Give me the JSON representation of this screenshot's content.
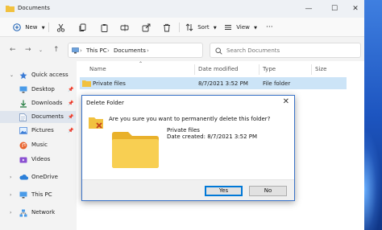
{
  "window": {
    "title": "Documents",
    "controls": [
      "—",
      "☐",
      "✕"
    ]
  },
  "toolbar": {
    "new_label": "New",
    "sort_label": "Sort",
    "view_label": "View",
    "more_label": "···"
  },
  "address": {
    "path": [
      "This PC",
      "Documents"
    ],
    "search_placeholder": "Search Documents"
  },
  "sidebar": {
    "items": [
      {
        "label": "Quick access",
        "icon": "star-icon"
      },
      {
        "label": "Desktop",
        "icon": "desktop-icon"
      },
      {
        "label": "Downloads",
        "icon": "download-icon"
      },
      {
        "label": "Documents",
        "icon": "documents-icon"
      },
      {
        "label": "Pictures",
        "icon": "pictures-icon"
      },
      {
        "label": "Music",
        "icon": "music-icon"
      },
      {
        "label": "Videos",
        "icon": "videos-icon"
      },
      {
        "label": "OneDrive",
        "icon": "cloud-icon"
      },
      {
        "label": "This PC",
        "icon": "pc-icon"
      },
      {
        "label": "Network",
        "icon": "network-icon"
      }
    ]
  },
  "list": {
    "columns": [
      "Name",
      "Date modified",
      "Type",
      "Size"
    ],
    "rows": [
      {
        "name": "Private files",
        "date": "8/7/2021 3:52 PM",
        "type": "File folder",
        "size": ""
      }
    ]
  },
  "dialog": {
    "title": "Delete Folder",
    "question": "Are you sure you want to permanently delete this folder?",
    "folder_name": "Private files",
    "date_created": "Date created: 8/7/2021 3:52 PM",
    "yes_label": "Yes",
    "no_label": "No"
  },
  "colors": {
    "accent": "#0078d7",
    "folder": "#f8c73e",
    "selection": "#cce4f7"
  }
}
